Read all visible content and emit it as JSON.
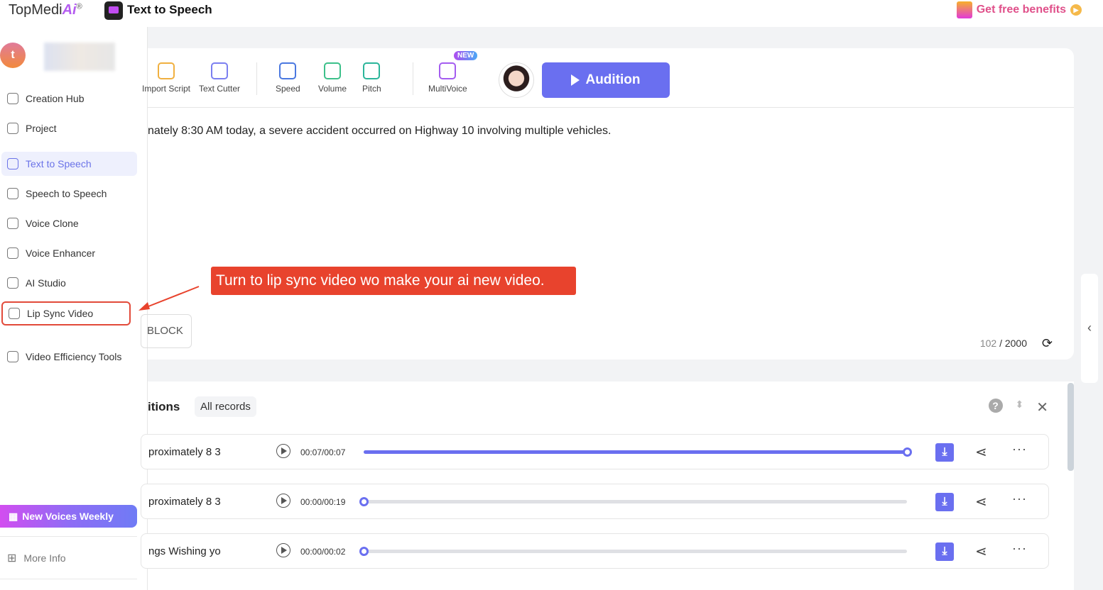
{
  "header": {
    "logo": "TopMedi",
    "logo_ai": "Ai",
    "logo_reg": "®",
    "app_title": "Text to Speech",
    "benefits": "Get free benefits"
  },
  "sidebar": {
    "avatar_letter": "t",
    "items": [
      {
        "label": "Creation Hub",
        "icon": "creation-hub-icon"
      },
      {
        "label": "Project",
        "icon": "folder-icon"
      },
      {
        "label": "Text to Speech",
        "icon": "text-to-speech-icon",
        "active": true
      },
      {
        "label": "Speech to Speech",
        "icon": "speech-icon"
      },
      {
        "label": "Voice Clone",
        "icon": "voice-clone-icon"
      },
      {
        "label": "Voice Enhancer",
        "icon": "microphone-icon"
      },
      {
        "label": "AI Studio",
        "icon": "pen-icon"
      },
      {
        "label": "Lip Sync Video",
        "icon": "lip-sync-icon",
        "highlighted": true
      },
      {
        "label": "Video Efficiency Tools",
        "icon": "toolbox-icon"
      }
    ],
    "promo": "New Voices Weekly",
    "more_info": "More Info"
  },
  "toolbar": {
    "tools": [
      {
        "label": "Import Script",
        "color": "#f0b040"
      },
      {
        "label": "Text Cutter",
        "color": "#7b7ff0"
      },
      {
        "label": "Speed",
        "color": "#4a78e0"
      },
      {
        "label": "Volume",
        "color": "#3cc08a"
      },
      {
        "label": "Pitch",
        "color": "#2bb59a"
      },
      {
        "label": "MultiVoice",
        "color": "#a45cf0"
      }
    ],
    "new_badge": "NEW",
    "audition": "Audition"
  },
  "editor": {
    "text": "nately 8:30 AM today, a severe accident occurred on Highway 10 involving multiple vehicles.",
    "block_button": "BLOCK",
    "count_used": "102",
    "count_total": "/ 2000"
  },
  "annotation": {
    "callout": "Turn to lip sync video wo make your ai new video."
  },
  "records": {
    "title": "itions",
    "filter": "All records",
    "rows": [
      {
        "name": "proximately 8 3",
        "time": "00:07/00:07",
        "progress": 1.0
      },
      {
        "name": "proximately 8 3",
        "time": "00:00/00:19",
        "progress": 0
      },
      {
        "name": "ngs Wishing yo",
        "time": "00:00/00:02",
        "progress": 0
      }
    ]
  },
  "colors": {
    "accent": "#6a6ff0",
    "annotation": "#e8432d"
  }
}
